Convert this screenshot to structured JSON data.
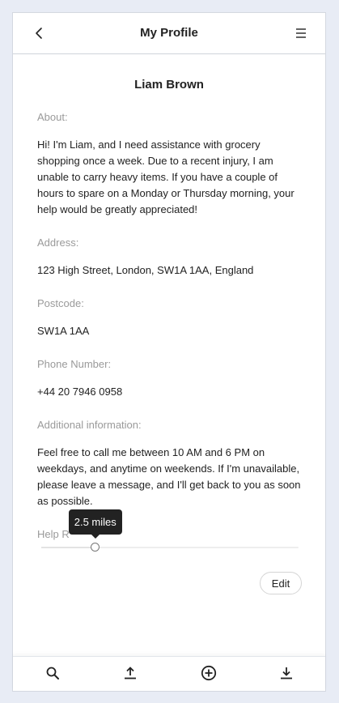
{
  "header": {
    "title": "My Profile",
    "back_icon": "chevron-left-icon",
    "menu_icon": "hamburger-menu-icon"
  },
  "profile": {
    "name": "Liam Brown",
    "about_label": "About:",
    "about": "Hi! I'm Liam, and I need assistance with grocery shopping once a week. Due to a recent injury, I am unable to carry heavy items. If you have a couple of hours to spare on a Monday or Thursday morning, your help would be greatly appreciated!",
    "address_label": "Address:",
    "address": "123 High Street, London, SW1A 1AA, England",
    "postcode_label": "Postcode:",
    "postcode": "SW1A 1AA",
    "phone_label": "Phone Number:",
    "phone": "+44 20 7946 0958",
    "additional_label": "Additional information:",
    "additional": "Feel free to call me between 10 AM and 6 PM on weekdays, and anytime on weekends. If I'm unavailable, please leave a message, and I'll get back to you as soon as possible.",
    "help_radius_label": "Help R",
    "help_radius_tooltip": "2.5 miles",
    "help_radius_fraction": 0.21
  },
  "actions": {
    "edit_label": "Edit"
  },
  "bottom_nav": {
    "items": [
      "search-icon",
      "upload-icon",
      "add-circle-icon",
      "download-icon"
    ]
  },
  "colors": {
    "background": "#e8ecf5",
    "label": "#9a9a9a",
    "text": "#222222",
    "tooltip": "#222222"
  }
}
